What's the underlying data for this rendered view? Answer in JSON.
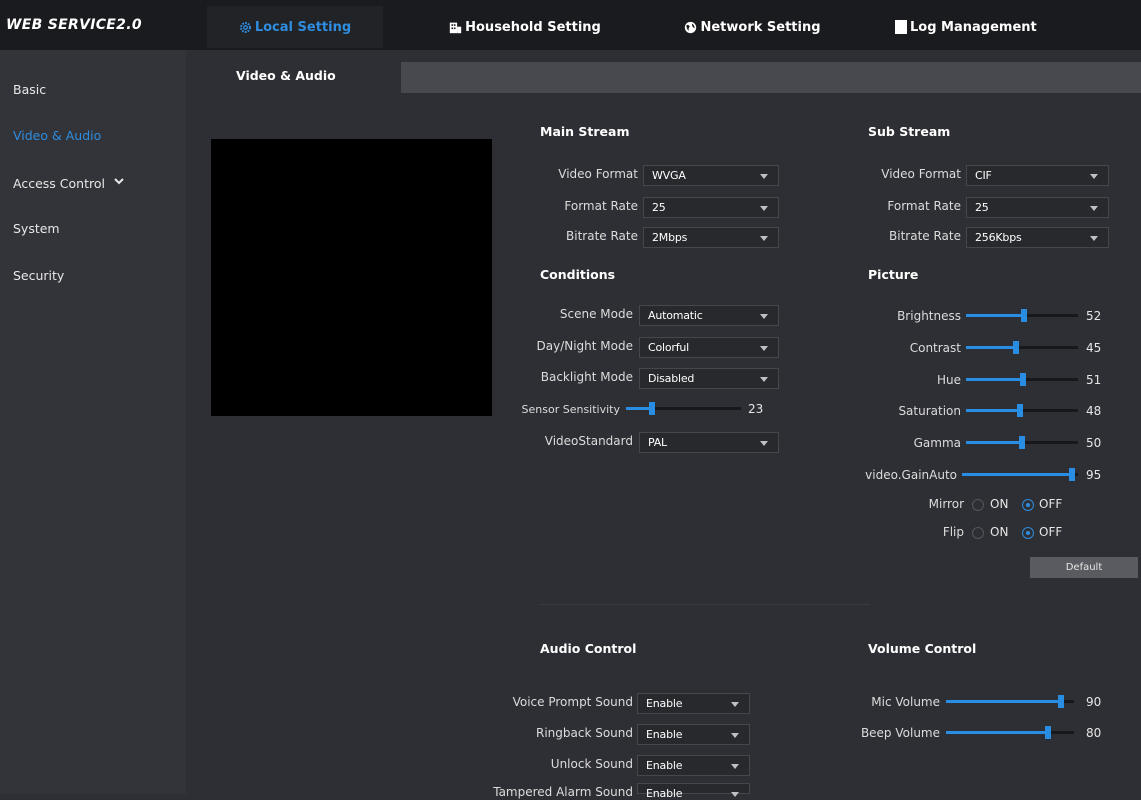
{
  "app": {
    "logo": "WEB SERVICE2.0"
  },
  "nav": [
    {
      "label": "Local Setting",
      "icon": "gear-icon"
    },
    {
      "label": "Household Setting",
      "icon": "building-icon"
    },
    {
      "label": "Network Setting",
      "icon": "globe-icon"
    },
    {
      "label": "Log Management",
      "icon": "document-icon"
    }
  ],
  "sidebar": {
    "items": [
      {
        "label": "Basic"
      },
      {
        "label": "Video & Audio"
      },
      {
        "label": "Access Control"
      },
      {
        "label": "System"
      },
      {
        "label": "Security"
      }
    ]
  },
  "tab": {
    "label": "Video & Audio"
  },
  "main_stream": {
    "title": "Main Stream",
    "video_format": {
      "label": "Video Format",
      "value": "WVGA"
    },
    "format_rate": {
      "label": "Format Rate",
      "value": "25"
    },
    "bitrate_rate": {
      "label": "Bitrate Rate",
      "value": "2Mbps"
    }
  },
  "sub_stream": {
    "title": "Sub Stream",
    "video_format": {
      "label": "Video Format",
      "value": "CIF"
    },
    "format_rate": {
      "label": "Format Rate",
      "value": "25"
    },
    "bitrate_rate": {
      "label": "Bitrate Rate",
      "value": "256Kbps"
    }
  },
  "conditions": {
    "title": "Conditions",
    "scene_mode": {
      "label": "Scene Mode",
      "value": "Automatic"
    },
    "day_night_mode": {
      "label": "Day/Night Mode",
      "value": "Colorful"
    },
    "backlight_mode": {
      "label": "Backlight Mode",
      "value": "Disabled"
    },
    "sensor_sensitivity": {
      "label": "Sensor Sensitivity",
      "value": 23,
      "display": "23"
    },
    "video_standard": {
      "label": "VideoStandard",
      "value": "PAL"
    }
  },
  "picture": {
    "title": "Picture",
    "sliders": [
      {
        "label": "Brightness",
        "value": 52,
        "display": "52"
      },
      {
        "label": "Contrast",
        "value": 45,
        "display": "45"
      },
      {
        "label": "Hue",
        "value": 51,
        "display": "51"
      },
      {
        "label": "Saturation",
        "value": 48,
        "display": "48"
      },
      {
        "label": "Gamma",
        "value": 50,
        "display": "50"
      },
      {
        "label": "video.GainAuto",
        "value": 95,
        "display": "95"
      }
    ],
    "mirror": {
      "label": "Mirror",
      "on": "ON",
      "off": "OFF",
      "selected": "OFF"
    },
    "flip": {
      "label": "Flip",
      "on": "ON",
      "off": "OFF",
      "selected": "OFF"
    },
    "default_button": "Default"
  },
  "audio_control": {
    "title": "Audio Control",
    "rows": [
      {
        "label": "Voice Prompt Sound",
        "value": "Enable"
      },
      {
        "label": "Ringback Sound",
        "value": "Enable"
      },
      {
        "label": "Unlock Sound",
        "value": "Enable"
      },
      {
        "label": "Tampered Alarm Sound",
        "value": "Enable"
      }
    ]
  },
  "volume_control": {
    "title": "Volume Control",
    "sliders": [
      {
        "label": "Mic Volume",
        "value": 90,
        "display": "90"
      },
      {
        "label": "Beep Volume",
        "value": 80,
        "display": "80"
      }
    ]
  },
  "colors": {
    "accent": "#2e8de0",
    "background": "#2e2f34",
    "topbar": "#1a1b1e"
  }
}
